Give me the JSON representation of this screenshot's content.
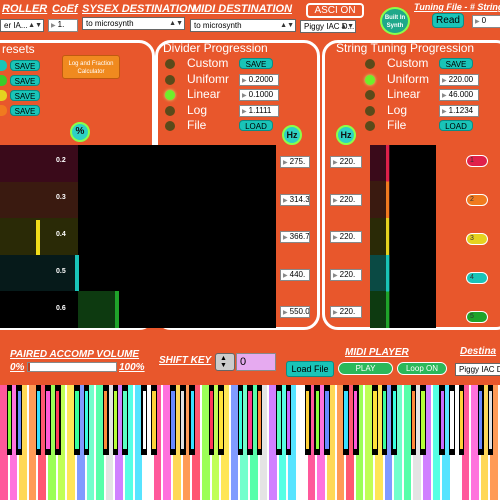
{
  "header": {
    "roller_label": "ROLLER",
    "roller_value": "er IA...",
    "coef_label": "CoEf",
    "coef_value": "1.",
    "sysex_label": "SYSEX DESTINATION",
    "sysex_value": "to microsynth",
    "midi_dest_label": "MIDI DESTINATION",
    "midi_dest_value": "to microsynth",
    "asci_button": "ASCI ON",
    "midi_dest2_value": "Piggy IAC D...",
    "built_in_synth": "Built In Synth",
    "tuning_file_label": "Tuning File - # String",
    "read_button": "Read",
    "tuning_value": "0"
  },
  "presets": {
    "title": "resets",
    "rows": [
      {
        "color": "#19c4b8",
        "save": "SAVE"
      },
      {
        "color": "#3acb2a",
        "save": "SAVE"
      },
      {
        "color": "#e5d21f",
        "save": "SAVE"
      },
      {
        "color": "#f07a1f",
        "save": "SAVE"
      }
    ],
    "calculator_button": "Log and Fraction Calculator",
    "percent_label": "%"
  },
  "divider": {
    "title": "Divider Progression",
    "options": [
      {
        "label": "Custom",
        "active": false,
        "control": "SAVE",
        "type": "button"
      },
      {
        "label": "Unifomr",
        "active": false,
        "control": "0.2000",
        "type": "number"
      },
      {
        "label": "Linear",
        "active": true,
        "control": "0.1000",
        "type": "number"
      },
      {
        "label": "Log",
        "active": false,
        "control": "1.1111",
        "type": "number"
      },
      {
        "label": "File",
        "active": false,
        "control": "LOAD",
        "type": "button"
      }
    ],
    "hz_label": "Hz",
    "ratios": [
      "0.2",
      "0.3",
      "0.4",
      "0.5",
      "0.6"
    ],
    "hz_values": [
      "275.",
      "314.3",
      "366.7",
      "440.",
      "550.0"
    ]
  },
  "string_tuning": {
    "title": "String Tuning Progression",
    "options": [
      {
        "label": "Custom",
        "active": false,
        "control": "SAVE",
        "type": "button"
      },
      {
        "label": "Uniform",
        "active": true,
        "control": "220.00",
        "type": "number"
      },
      {
        "label": "Linear",
        "active": false,
        "control": "46.000",
        "type": "number"
      },
      {
        "label": "Log",
        "active": false,
        "control": "1.1234",
        "type": "number"
      },
      {
        "label": "File",
        "active": false,
        "control": "LOAD",
        "type": "button"
      }
    ],
    "hz_label": "Hz",
    "hz_values": [
      "220.",
      "220.",
      "220.",
      "220.",
      "220."
    ],
    "strings": [
      {
        "num": "1",
        "color": "#e0204a"
      },
      {
        "num": "2",
        "color": "#f07a1f"
      },
      {
        "num": "3",
        "color": "#e5d21f"
      },
      {
        "num": "4",
        "color": "#19c4b8"
      },
      {
        "num": "5",
        "color": "#1fa32a"
      }
    ]
  },
  "bottom": {
    "paired_label": "PAIRED ACCOMP VOLUME",
    "min_label": "0%",
    "max_label": "100%",
    "volume_fraction": 0.02,
    "shift_key_label": "SHIFT KEY",
    "shift_value": "0",
    "midi_player_label": "MIDI PLAYER",
    "load_file": "Load File",
    "play": "PLAY",
    "loop": "Loop ON",
    "dest_label": "Destina",
    "dest_value": "Piggy IAC D"
  },
  "keyboard_colors": [
    "#ff3b8a",
    "#ffe23a",
    "#3ae0ff",
    "#8aff3a",
    "#c86bff",
    "#ff8a3a",
    "#3aff9c",
    "#ff5ad8",
    "#6a8aff",
    "#ffffff",
    "#b6ff3a",
    "#3affe0",
    "#ff3a5a",
    "#e0e0e0",
    "#ffd23a",
    "#5affc4"
  ]
}
